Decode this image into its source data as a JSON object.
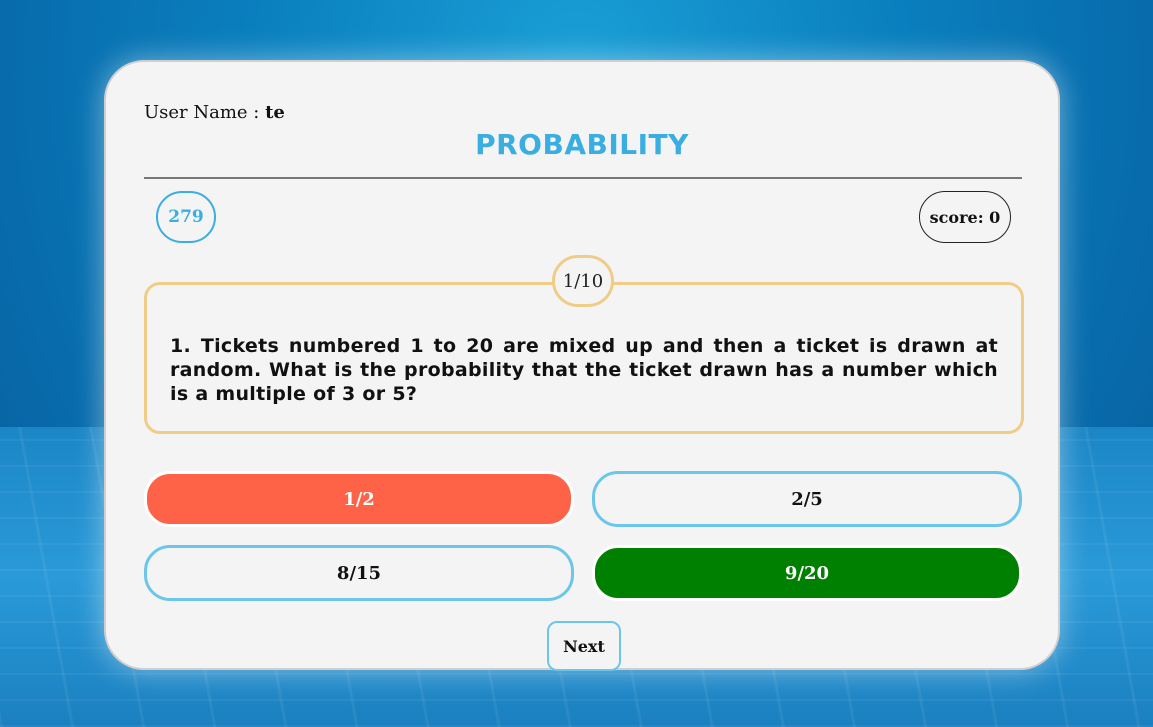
{
  "user": {
    "label": "User Name : ",
    "name": "te"
  },
  "quiz": {
    "title": "PROBABILITY",
    "timer": "279",
    "score": "score: 0",
    "counter": "1/10",
    "question": "1. Tickets numbered 1 to 20 are mixed up and then a ticket is drawn at random. What is the probability that the ticket drawn has a number which is a multiple of 3 or 5?",
    "options": [
      {
        "label": "1/2",
        "state": "wrong"
      },
      {
        "label": "2/5",
        "state": "neutral"
      },
      {
        "label": "8/15",
        "state": "neutral"
      },
      {
        "label": "9/20",
        "state": "correct"
      }
    ],
    "next_label": "Next"
  },
  "colors": {
    "accent": "#3aaee0",
    "question_border": "#efcd88",
    "wrong": "#ff6347",
    "correct": "#008000",
    "option_border": "#6cc6ea"
  }
}
